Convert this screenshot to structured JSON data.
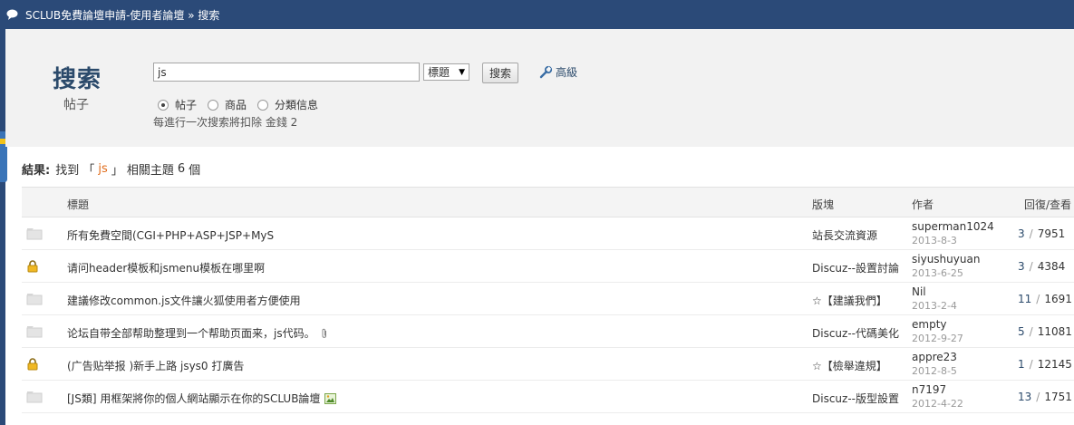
{
  "header": {
    "breadcrumb": "SCLUB免費論壇申請-使用者論壇 » 搜索"
  },
  "search_panel": {
    "title": "搜索",
    "subtitle": "帖子",
    "query": "js",
    "type_select": "標題",
    "search_button": "搜索",
    "advanced_link": "高級",
    "radios": [
      {
        "label": "帖子",
        "checked": true
      },
      {
        "label": "商品",
        "checked": false
      },
      {
        "label": "分類信息",
        "checked": false
      }
    ],
    "cost_note": "每進行一次搜索將扣除 金錢 2"
  },
  "results": {
    "label": "結果:",
    "prefix": "找到 「",
    "keyword": "js",
    "suffix": "」 相關主題",
    "count": "6",
    "unit": "個"
  },
  "table": {
    "headers": {
      "title": "標題",
      "forum": "版塊",
      "author": "作者",
      "stats": "回復/查看"
    },
    "rows": [
      {
        "icon": "folder-icon",
        "title": "所有免費空間(CGI+PHP+ASP+JSP+MyS",
        "forum": "站長交流資源",
        "author": "superman1024",
        "date": "2013-8-3",
        "replies": "3",
        "views": "7951"
      },
      {
        "icon": "lock-icon",
        "title": "请问header模板和jsmenu模板在哪里啊",
        "forum": "Discuz--設置討論",
        "author": "siyushuyuan",
        "date": "2013-6-25",
        "replies": "3",
        "views": "4384"
      },
      {
        "icon": "folder-icon",
        "title": "建議修改common.js文件讓火狐使用者方便使用",
        "forum": "☆【建議我們】",
        "author": "Nil",
        "date": "2013-2-4",
        "replies": "11",
        "views": "1691"
      },
      {
        "icon": "folder-icon",
        "title": "论坛自带全部帮助整理到一个帮助页面来，js代码。",
        "forum": "Discuz--代碼美化",
        "author": "empty",
        "date": "2012-9-27",
        "replies": "5",
        "views": "11081"
      },
      {
        "icon": "lock-icon",
        "title": "(广告贴举报 )新手上路 jsys0 打廣告",
        "forum": "☆【檢舉違規】",
        "author": "appre23",
        "date": "2012-8-5",
        "replies": "1",
        "views": "12145"
      },
      {
        "icon": "folder-icon",
        "title": "[JS類] 用框架將你的個人網站顯示在你的SCLUB論壇",
        "forum": "Discuz--版型設置",
        "author": "n7197",
        "date": "2012-4-22",
        "replies": "13",
        "views": "1751"
      }
    ]
  }
}
